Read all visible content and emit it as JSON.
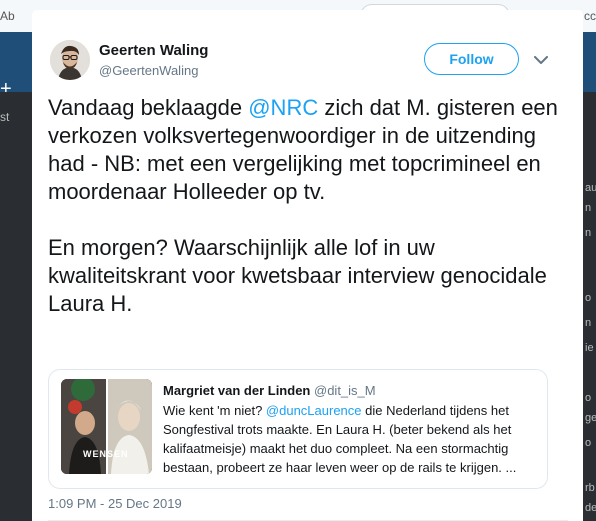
{
  "background": {
    "left_fragment": "Ab",
    "right_fragment": "cc",
    "side_fragment": "st",
    "right_column_fragments": [
      "au",
      "n",
      "n",
      "o",
      "n",
      "ie",
      "o",
      "ge",
      "o",
      "rb",
      "de"
    ]
  },
  "tweet": {
    "author_name": "Geerten Waling",
    "author_handle": "@GeertenWaling",
    "follow_label": "Follow",
    "caret_icon": "chevron-down-icon",
    "para1_before": "Vandaag beklaagde ",
    "para1_mention": "@NRC",
    "para1_after": " zich dat M. gisteren een verkozen volksvertegenwoordiger in de uitzending had - NB: met een vergelijking met topcrimineel en moordenaar Holleeder op tv.",
    "para2": "En morgen? Waarschijnlijk alle lof in uw kwaliteitskrant voor kwetsbaar interview genocidale Laura H.",
    "timestamp": "1:09 PM - 25 Dec 2019"
  },
  "quoted": {
    "author_name": "Margriet van der Linden",
    "author_handle": "@dit_is_M",
    "text_before": "Wie kent 'm niet? ",
    "text_mention": "@duncLaurence",
    "text_after": " die Nederland tijdens het Songfestival trots maakte. En Laura H. (beter bekend als het kalifaatmeisje) maakt het duo compleet. Na een stormachtig bestaan, probeert ze haar leven weer op de rails te krijgen. ...",
    "media_caption": "WENSEN"
  },
  "colors": {
    "accent": "#1da1f2",
    "text": "#14171a",
    "secondary": "#657786",
    "border": "#e1e8ed"
  }
}
